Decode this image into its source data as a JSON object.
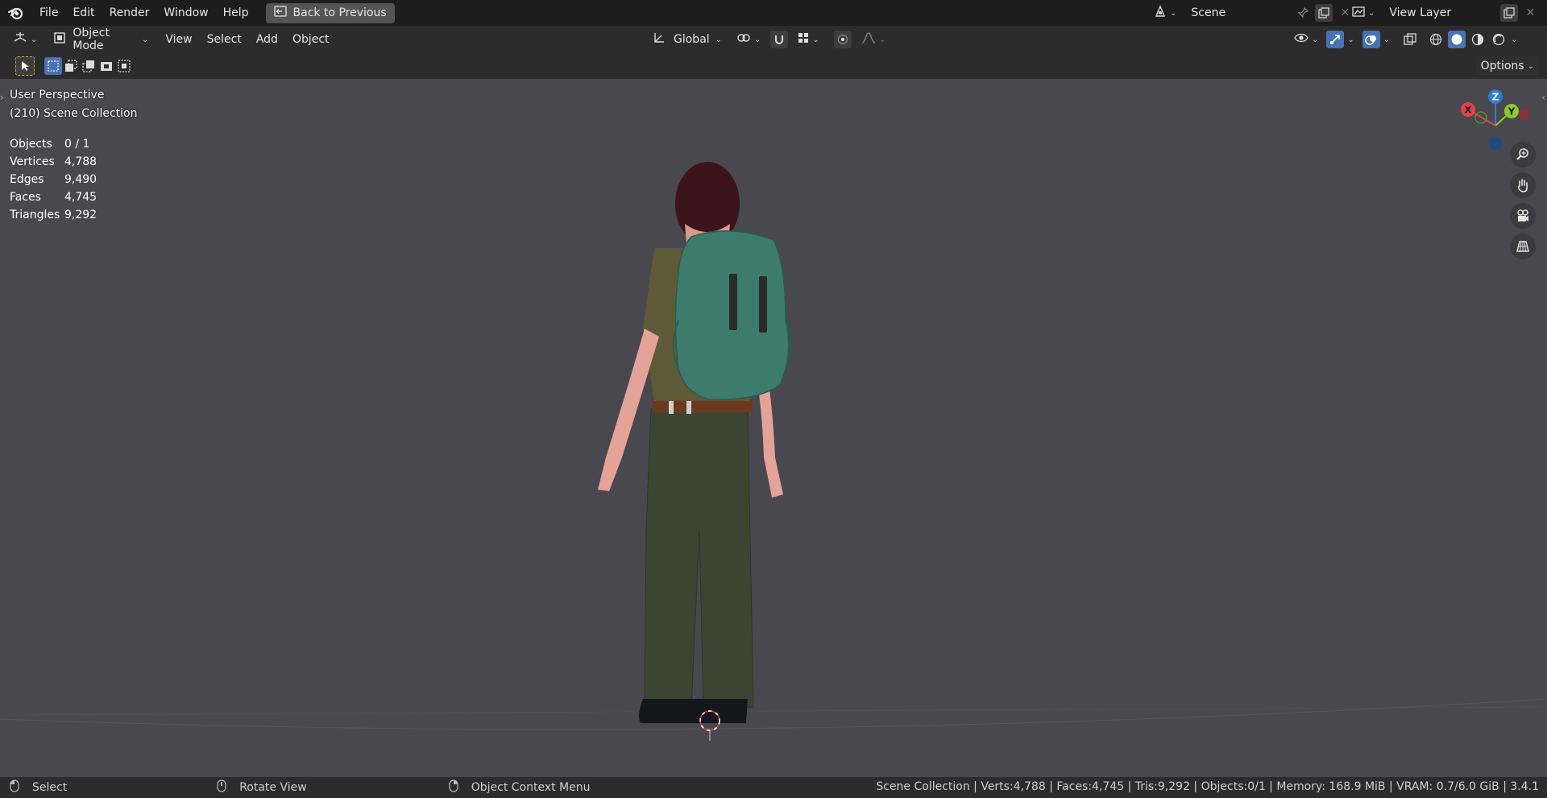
{
  "topbar": {
    "menus": [
      "File",
      "Edit",
      "Render",
      "Window",
      "Help"
    ],
    "back_button": "Back to Previous",
    "scene_label": "Scene",
    "view_layer_label": "View Layer"
  },
  "header": {
    "mode": "Object Mode",
    "menus": [
      "View",
      "Select",
      "Add",
      "Object"
    ],
    "transform_orientation": "Global",
    "options_label": "Options"
  },
  "viewport": {
    "perspective": "User Perspective",
    "collection": "(210) Scene Collection",
    "stats": [
      {
        "label": "Objects",
        "value": "0 / 1"
      },
      {
        "label": "Vertices",
        "value": "4,788"
      },
      {
        "label": "Edges",
        "value": "9,490"
      },
      {
        "label": "Faces",
        "value": "4,745"
      },
      {
        "label": "Triangles",
        "value": "9,292"
      }
    ],
    "gizmo": {
      "x": "X",
      "y": "Y",
      "z": "Z"
    }
  },
  "statusbar": {
    "select": "Select",
    "rotate": "Rotate View",
    "context": "Object Context Menu",
    "info": "Scene Collection | Verts:4,788 | Faces:4,745 | Tris:9,292 | Objects:0/1 | Memory: 168.9 MiB | VRAM: 0.7/6.0 GiB | 3.4.1"
  },
  "colors": {
    "accent": "#4772b3",
    "axis_x": "#e5434f",
    "axis_y": "#8bcb2d",
    "axis_z": "#2d7ed1"
  }
}
